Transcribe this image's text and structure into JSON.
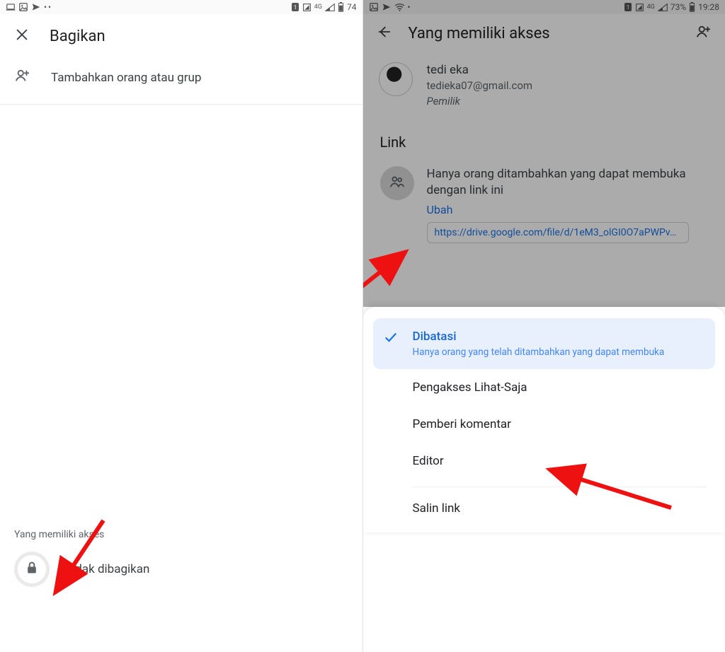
{
  "left": {
    "statusbar": {
      "battery": "74"
    },
    "share_title": "Bagikan",
    "add_people": "Tambahkan orang atau grup",
    "who_has_access": "Yang memiliki akses",
    "not_shared": "Tidak dibagikan"
  },
  "right": {
    "statusbar": {
      "battery": "73%",
      "time": "19:28"
    },
    "title": "Yang memiliki akses",
    "owner": {
      "name": "tedi eka",
      "email": "tedieka07@gmail.com",
      "role": "Pemilik"
    },
    "link": {
      "heading": "Link",
      "description": "Hanya orang ditambahkan yang dapat membuka dengan link ini",
      "change": "Ubah",
      "url": "https://drive.google.com/file/d/1eM3_olGI0O7aPWPv…"
    },
    "sheet": {
      "restricted": {
        "title": "Dibatasi",
        "sub": "Hanya orang yang telah ditambahkan yang dapat membuka"
      },
      "viewer": "Pengakses Lihat-Saja",
      "commenter": "Pemberi komentar",
      "editor": "Editor",
      "copy_link": "Salin link"
    }
  }
}
